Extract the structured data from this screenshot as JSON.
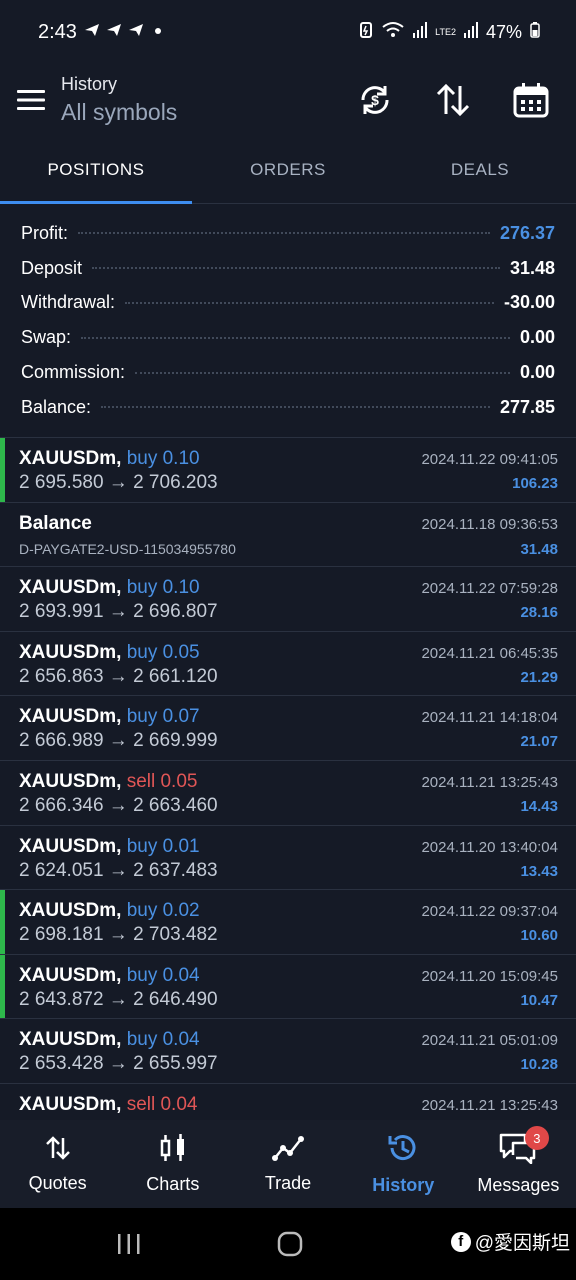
{
  "status_bar": {
    "time": "2:43",
    "battery": "47%",
    "network_label": "LTE2"
  },
  "header": {
    "title": "History",
    "subtitle": "All symbols"
  },
  "tabs": [
    {
      "label": "POSITIONS",
      "active": true
    },
    {
      "label": "ORDERS",
      "active": false
    },
    {
      "label": "DEALS",
      "active": false
    }
  ],
  "summary": [
    {
      "label": "Profit:",
      "value": "276.37"
    },
    {
      "label": "Deposit",
      "value": "31.48"
    },
    {
      "label": "Withdrawal:",
      "value": "-30.00"
    },
    {
      "label": "Swap:",
      "value": "0.00"
    },
    {
      "label": "Commission:",
      "value": "0.00"
    },
    {
      "label": "Balance:",
      "value": "277.85"
    }
  ],
  "rows": [
    {
      "symbol": "XAUUSDm,",
      "side": "buy 0.10",
      "prices": "2 695.580 → 2 706.203",
      "date": "2024.11.22 09:41:05",
      "profit": "106.23"
    },
    {
      "symbol": "Balance",
      "sub": "D-PAYGATE2-USD-115034955780",
      "date": "2024.11.18 09:36:53",
      "profit": "31.48"
    },
    {
      "symbol": "XAUUSDm,",
      "side": "buy 0.10",
      "prices": "2 693.991 → 2 696.807",
      "date": "2024.11.22 07:59:28",
      "profit": "28.16"
    },
    {
      "symbol": "XAUUSDm,",
      "side": "buy 0.05",
      "prices": "2 656.863 → 2 661.120",
      "date": "2024.11.21 06:45:35",
      "profit": "21.29"
    },
    {
      "symbol": "XAUUSDm,",
      "side": "buy 0.07",
      "prices": "2 666.989 → 2 669.999",
      "date": "2024.11.21 14:18:04",
      "profit": "21.07"
    },
    {
      "symbol": "XAUUSDm,",
      "side": "sell 0.05",
      "prices": "2 666.346 → 2 663.460",
      "date": "2024.11.21 13:25:43",
      "profit": "14.43"
    },
    {
      "symbol": "XAUUSDm,",
      "side": "buy 0.01",
      "prices": "2 624.051 → 2 637.483",
      "date": "2024.11.20 13:40:04",
      "profit": "13.43"
    },
    {
      "symbol": "XAUUSDm,",
      "side": "buy 0.02",
      "prices": "2 698.181 → 2 703.482",
      "date": "2024.11.22 09:37:04",
      "profit": "10.60"
    },
    {
      "symbol": "XAUUSDm,",
      "side": "buy 0.04",
      "prices": "2 643.872 → 2 646.490",
      "date": "2024.11.20 15:09:45",
      "profit": "10.47"
    },
    {
      "symbol": "XAUUSDm,",
      "side": "buy 0.04",
      "prices": "2 653.428 → 2 655.997",
      "date": "2024.11.21 05:01:09",
      "profit": "10.28"
    },
    {
      "symbol": "XAUUSDm,",
      "side": "sell 0.04",
      "prices": "",
      "date": "2024.11.21 13:25:43",
      "profit": ""
    }
  ],
  "bottom_nav": [
    {
      "label": "Quotes",
      "icon": "swap-vertical-icon"
    },
    {
      "label": "Charts",
      "icon": "candlestick-icon"
    },
    {
      "label": "Trade",
      "icon": "trend-line-icon"
    },
    {
      "label": "History",
      "icon": "history-clock-icon",
      "active": true
    },
    {
      "label": "Messages",
      "icon": "chat-bubbles-icon",
      "badge": "3"
    }
  ],
  "watermark": "@愛因斯坦",
  "colors": {
    "background": "#151a26",
    "accent": "#4a90e2",
    "sell": "#e05656",
    "marker": "#2eb84b"
  }
}
